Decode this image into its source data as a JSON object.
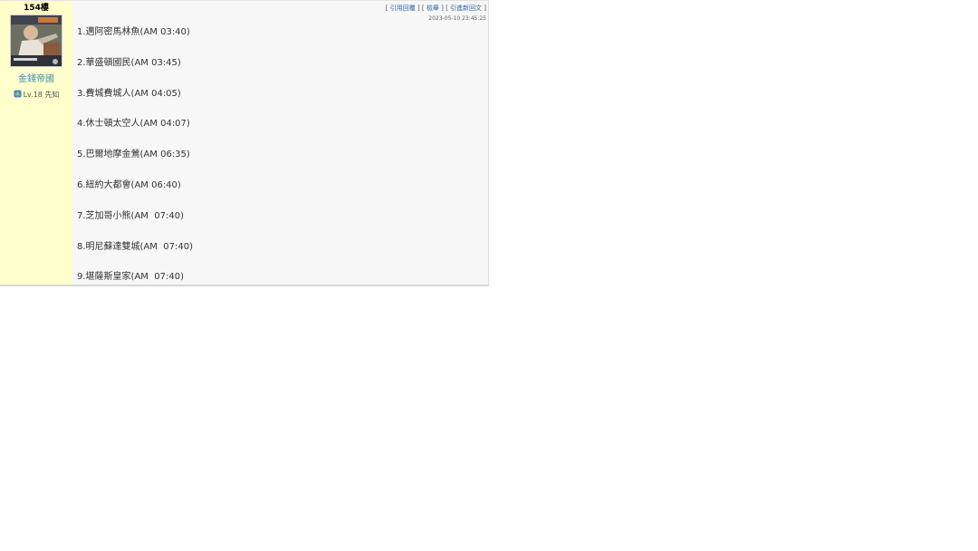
{
  "post": {
    "floor": "154樓",
    "username": "金錢帝國",
    "level": "Lv.18 先知",
    "links": {
      "quote_reply": "引用回覆",
      "report": "檢舉",
      "reply_new": "引進新回文"
    },
    "timestamp": "2023-05-10 23:45:25",
    "games": [
      "1.邁阿密馬林魚(AM 03:40)",
      "2.華盛頓國民(AM 03:45)",
      "3.費城費城人(AM 04:05)",
      "4.休士頓太空人(AM 04:07)",
      "5.巴爾地摩金鶯(AM 06:35)",
      "6.紐約大都會(AM 06:40)",
      "7.芝加哥小熊(AM  07:40)",
      "8.明尼蘇達雙城(AM  07:40)",
      "9.堪薩斯皇家(AM  07:40)"
    ]
  },
  "icons": {
    "avatar": "avatar-image",
    "level": "level-badge-icon"
  },
  "colors": {
    "author_panel": "#ffffcc",
    "content_bg": "#f7f7f7",
    "username": "#3a8fb0",
    "link": "#3366aa"
  }
}
